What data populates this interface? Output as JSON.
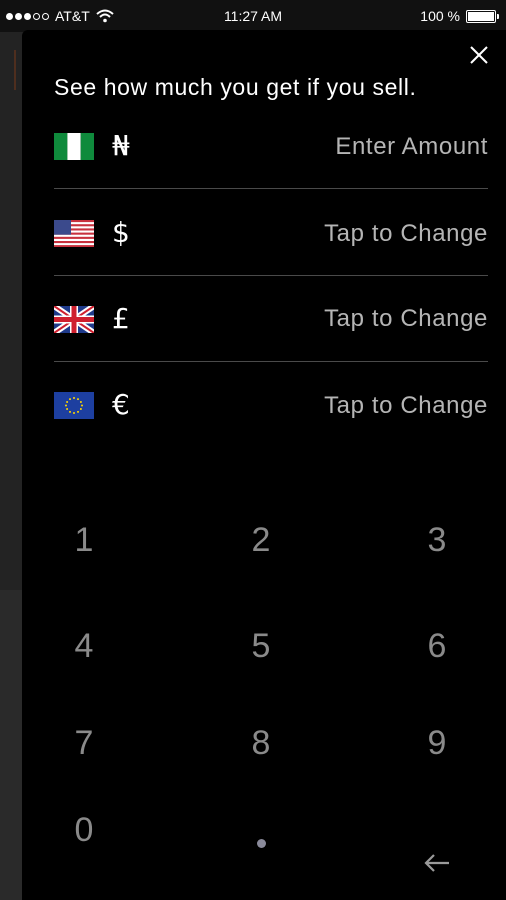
{
  "status_bar": {
    "carrier": "AT&T",
    "time": "11:27 AM",
    "battery": "100 %"
  },
  "modal": {
    "title": "See how much you get if you sell.",
    "close_icon": "close-icon"
  },
  "currencies": [
    {
      "flag": "nigeria-flag-icon",
      "symbol": "₦",
      "value": "Enter Amount"
    },
    {
      "flag": "usa-flag-icon",
      "symbol": "$",
      "value": "Tap to Change"
    },
    {
      "flag": "uk-flag-icon",
      "symbol": "£",
      "value": "Tap to Change"
    },
    {
      "flag": "eu-flag-icon",
      "symbol": "€",
      "value": "Tap to Change"
    }
  ],
  "keypad": {
    "keys": [
      "1",
      "2",
      "3",
      "4",
      "5",
      "6",
      "7",
      "8",
      "9",
      "0"
    ],
    "decimal_icon": "decimal-dot-icon",
    "backspace_icon": "backspace-arrow-icon"
  },
  "colors": {
    "modal_bg": "#000000",
    "key_text": "#8a8a8a",
    "row_value_text": "#b5b5b5",
    "divider": "#4a4a4a"
  }
}
